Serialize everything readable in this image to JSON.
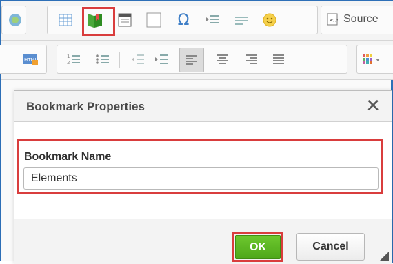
{
  "toolbar": {
    "source_label": "Source"
  },
  "dialog": {
    "title": "Bookmark Properties",
    "close_glyph": "✕",
    "field_label": "Bookmark Name",
    "field_value": "Elements",
    "ok_label": "OK",
    "cancel_label": "Cancel"
  },
  "colors": {
    "highlight": "#d93d3d",
    "ok_green": "#5cb82a",
    "frame_blue": "#2d6fb7"
  },
  "icons": {
    "row1": [
      "image-icon",
      "table-icon",
      "bookmark-icon",
      "template-icon",
      "blank-icon",
      "omega-icon",
      "indent-list-icon",
      "horizontal-rule-icon",
      "smiley-icon",
      "source-icon"
    ],
    "row2": [
      "flash-icon",
      "numbered-list-icon",
      "bulleted-list-icon",
      "outdent-icon",
      "indent-icon",
      "align-left-icon",
      "align-center-icon",
      "align-right-icon",
      "justify-icon",
      "color-grid-icon"
    ]
  }
}
